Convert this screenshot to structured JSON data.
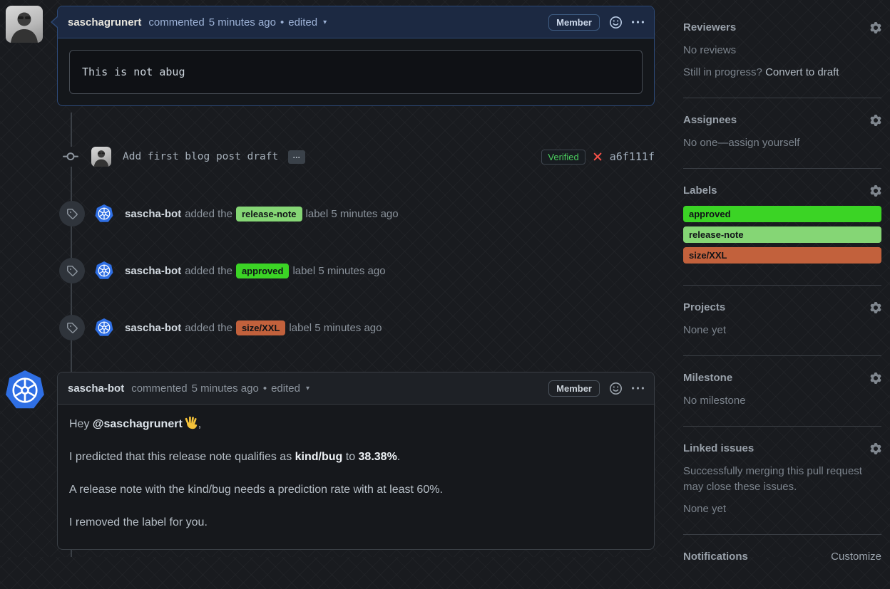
{
  "comment1": {
    "author": "saschagrunert",
    "action": "commented",
    "time": "5 minutes ago",
    "bullet": "•",
    "edited_label": "edited",
    "caret": "▾",
    "member_badge": "Member",
    "code_text": "This is not abug"
  },
  "commit": {
    "message": "Add first blog post draft",
    "more": "…",
    "verified": "Verified",
    "hash": "a6f111f"
  },
  "events": [
    {
      "actor": "sascha-bot",
      "action": "added the",
      "label": "release-note",
      "label_color": "#85d675",
      "tail": "label 5 minutes ago"
    },
    {
      "actor": "sascha-bot",
      "action": "added the",
      "label": "approved",
      "label_color": "#3bd425",
      "tail": "label 5 minutes ago"
    },
    {
      "actor": "sascha-bot",
      "action": "added the",
      "label": "size/XXL",
      "label_color": "#c2613c",
      "tail": "label 5 minutes ago"
    }
  ],
  "comment2": {
    "author": "sascha-bot",
    "action": "commented",
    "time": "5 minutes ago",
    "bullet": "•",
    "edited_label": "edited",
    "caret": "▾",
    "member_badge": "Member",
    "p1_pre": "Hey ",
    "p1_mention": "@saschagrunert",
    "p1_emoji": "👋",
    "p1_post": ",",
    "p2_pre": "I predicted that this release note qualifies as ",
    "p2_bold1": "kind/bug",
    "p2_mid": " to ",
    "p2_bold2": "38.38%",
    "p2_post": ".",
    "p3": "A release note with the kind/bug needs a prediction rate with at least 60%.",
    "p4": "I removed the label for you."
  },
  "sidebar": {
    "reviewers": {
      "title": "Reviewers",
      "empty": "No reviews",
      "draft_pre": "Still in progress? ",
      "draft_link": "Convert to draft"
    },
    "assignees": {
      "title": "Assignees",
      "empty_pre": "No one—",
      "empty_link": "assign yourself"
    },
    "labels": {
      "title": "Labels",
      "items": [
        {
          "name": "approved",
          "color": "#3bd425"
        },
        {
          "name": "release-note",
          "color": "#85d675"
        },
        {
          "name": "size/XXL",
          "color": "#c2613c"
        }
      ]
    },
    "projects": {
      "title": "Projects",
      "empty": "None yet"
    },
    "milestone": {
      "title": "Milestone",
      "empty": "No milestone"
    },
    "linked_issues": {
      "title": "Linked issues",
      "desc": "Successfully merging this pull request may close these issues.",
      "empty": "None yet"
    },
    "notifications": {
      "title": "Notifications",
      "link": "Customize"
    }
  }
}
